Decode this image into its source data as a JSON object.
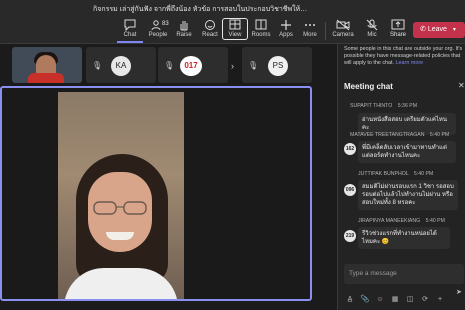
{
  "window": {
    "meeting_title": "กิจกรรม เล่าสู่กันฟัง จากพี่ถึงน้อง หัวข้อ การสอบในประกอบวิชาชีพให้ผ่..."
  },
  "toolbar": {
    "chat_label": "Chat",
    "people_label": "People",
    "people_count": "83",
    "raise_label": "Raise",
    "react_label": "React",
    "view_label": "View",
    "rooms_label": "Rooms",
    "apps_label": "Apps",
    "more_label": "More",
    "camera_label": "Camera",
    "mic_label": "Mic",
    "share_label": "Share",
    "leave_label": "Leave"
  },
  "participants": [
    {
      "initials": "KA",
      "color": "#e8e8e8"
    },
    {
      "initials": "017",
      "color": "#e34a3f"
    },
    {
      "initials": "PS",
      "color": "#f0f0f0"
    }
  ],
  "panel": {
    "notice_text": "Some people in this chat are outside your org. It's possible they have message-related policies that will apply to the chat.",
    "learn_more": "Learn more",
    "title": "Meeting chat",
    "messages": [
      {
        "author": "SUPAPIT THINTO",
        "time": "5:36 PM",
        "text": "อ่านหนังสือสอบ เตรียมตัวแค่ไหนคะ",
        "avatar": ""
      },
      {
        "author": "MATAVEE TREETANGTRAGAN",
        "time": "5:40 PM",
        "text": "พี่มีเคล็ดลับเวลาเข้ามาทานทำแต่แต่ลอร์ดทำงานไหนคะ",
        "avatar": "162"
      },
      {
        "author": "JUTTIPAK BUNPHOL",
        "time": "5:40 PM",
        "text": "สมมติไม่ผ่านรอบแรก 1 วิชา รอสอบรอบต่อไปแล้วไปทำงานไม่ผ่าน หรือสอบใหม่ทั้ง 8 หรอคะ",
        "avatar": "096"
      },
      {
        "author": "JIRAPINYA MANEEKIANG",
        "time": "5:40 PM",
        "text": "รีวิวช่วงแรกที่ทำงานหน่อยได้ไหมคะ 😊",
        "avatar": "219"
      }
    ],
    "compose_placeholder": "Type a message"
  }
}
